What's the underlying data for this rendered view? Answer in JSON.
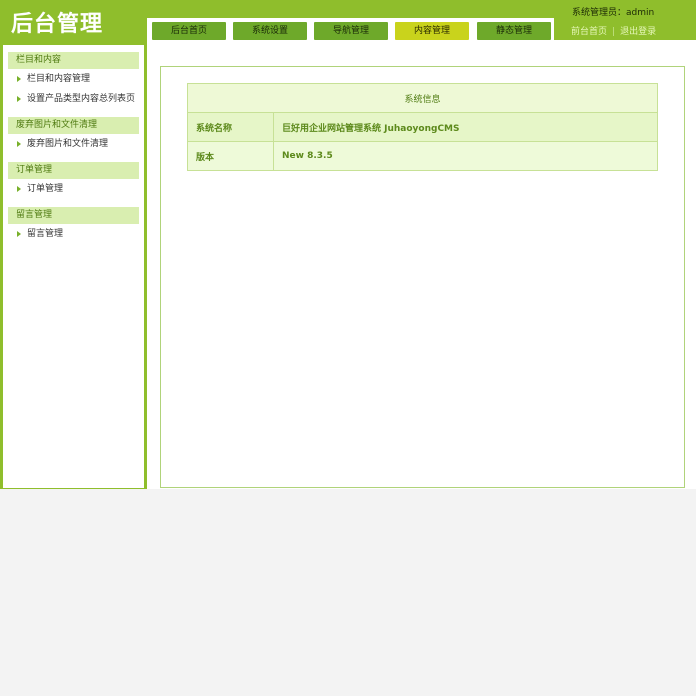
{
  "app": {
    "logo_text": "后台管理"
  },
  "nav": {
    "tabs": [
      {
        "label": "后台首页",
        "active": false
      },
      {
        "label": "系统设置",
        "active": false
      },
      {
        "label": "导航管理",
        "active": false
      },
      {
        "label": "内容管理",
        "active": true
      },
      {
        "label": "静态管理",
        "active": false
      }
    ]
  },
  "user": {
    "info": "系统管理员：admin",
    "links": [
      "前台首页",
      "退出登录"
    ],
    "separator": "|"
  },
  "sidebar": {
    "sections": [
      {
        "title": "栏目和内容",
        "items": [
          "栏目和内容管理",
          "设置产品类型内容总列表页"
        ]
      },
      {
        "title": "废弃图片和文件清理",
        "items": [
          "废弃图片和文件清理"
        ]
      },
      {
        "title": "订单管理",
        "items": [
          "订单管理"
        ]
      },
      {
        "title": "留言管理",
        "items": [
          "留言管理"
        ]
      }
    ]
  },
  "system_info": {
    "header": "系统信息",
    "rows": [
      {
        "key": "系统名称",
        "value": "巨好用企业网站管理系统 JuhaoyongCMS"
      },
      {
        "key": "版本",
        "value": "New 8.3.5"
      }
    ]
  },
  "colors": {
    "brand_green": "#8fbe2c",
    "tab_green": "#6ea92a",
    "tab_active": "#c9d31c",
    "section_bg": "#d9eeb0"
  }
}
